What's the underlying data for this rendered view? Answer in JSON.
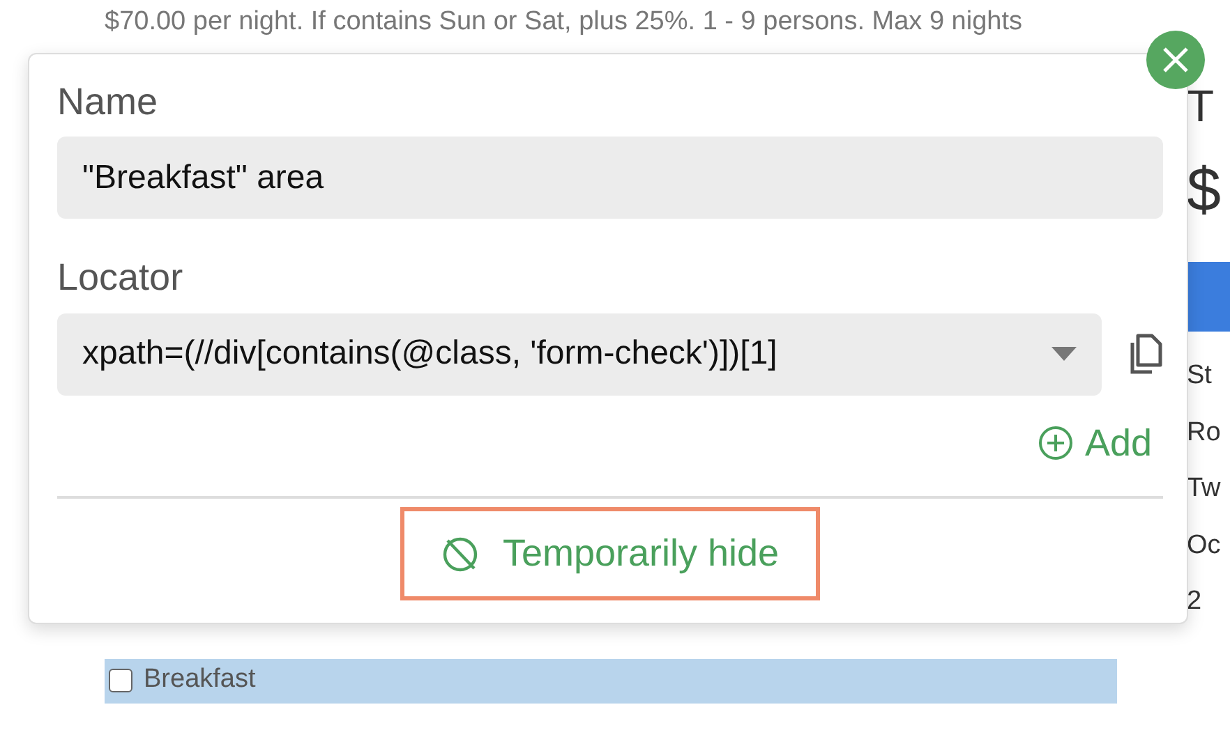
{
  "page": {
    "rate_note": "$70.00 per night. If contains Sun or Sat, plus 25%. 1 - 9 persons. Max 9 nights",
    "side_fragments": [
      "T",
      "$",
      "St",
      "Ro",
      "Tw",
      "Oc",
      "2"
    ],
    "plan_option": {
      "label": "Breakfast",
      "checked": false,
      "highlighted": true
    }
  },
  "popup": {
    "name_label": "Name",
    "name_value": "\"Breakfast\" area",
    "locator_label": "Locator",
    "locator_value": "xpath=(//div[contains(@class, 'form-check')])[1]",
    "add_button": "Add",
    "hide_button": "Temporarily hide"
  }
}
